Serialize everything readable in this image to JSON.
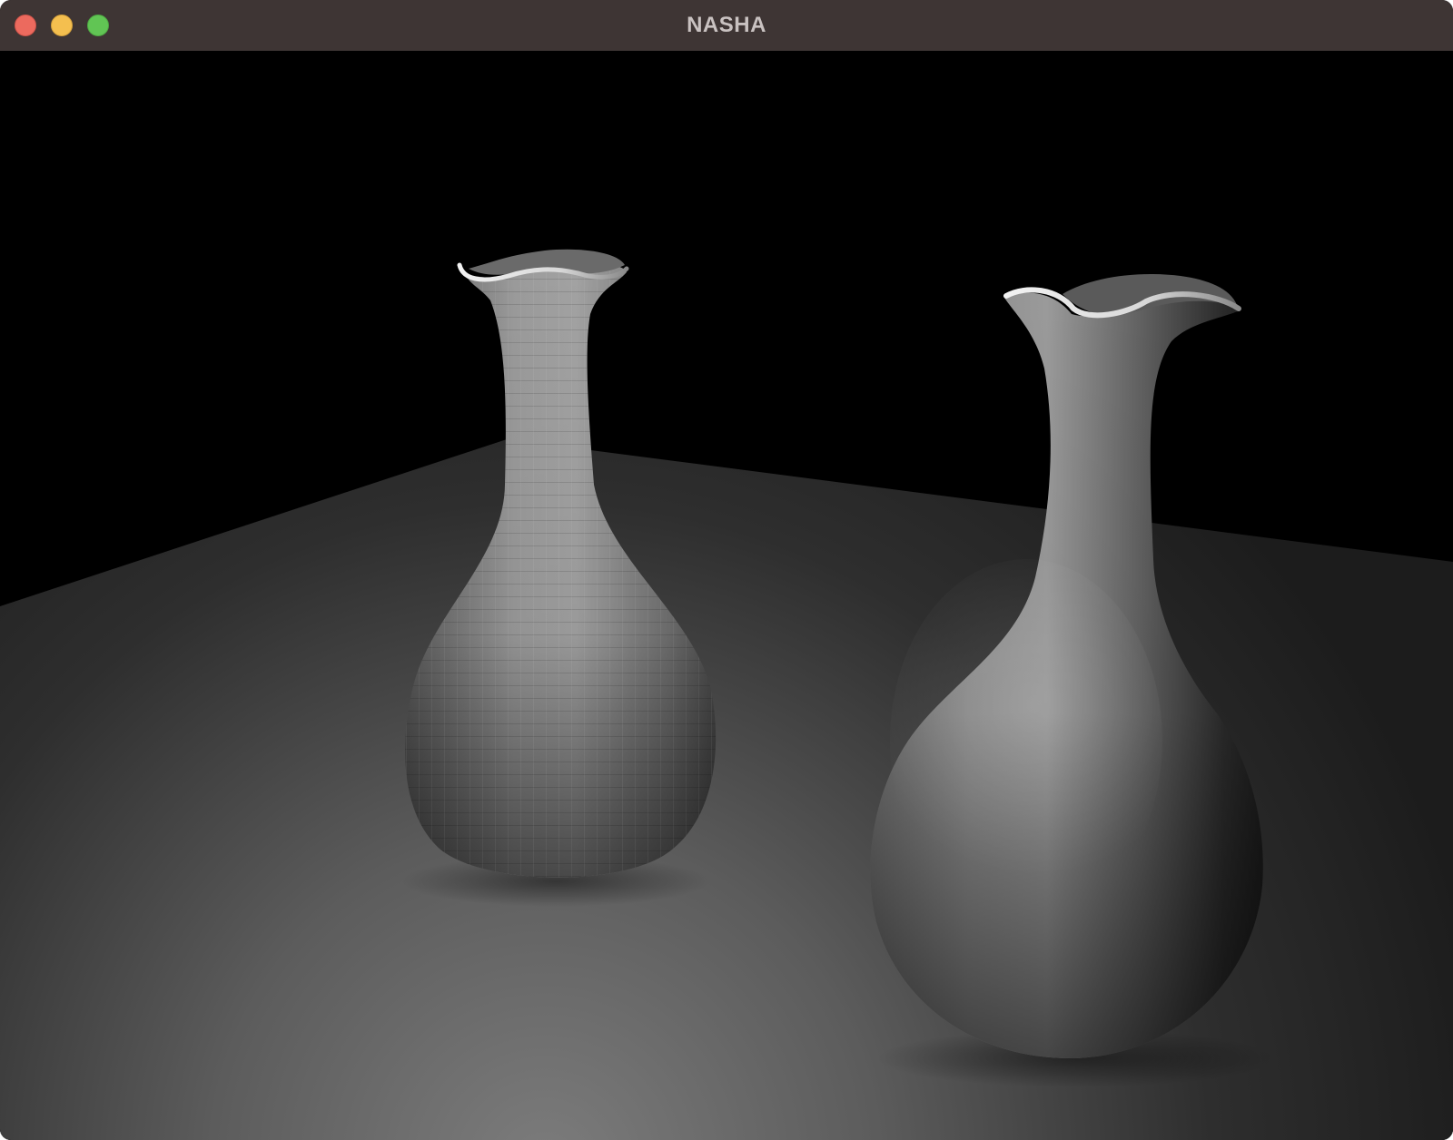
{
  "window": {
    "title": "NASHA",
    "controls": {
      "close_color": "#ec6a5e",
      "minimize_color": "#f4bf4f",
      "zoom_color": "#61c554"
    }
  },
  "scene": {
    "background_color": "#000000",
    "floor_color": "#7a7a7a",
    "objects": [
      {
        "name": "faceted-vase",
        "shading": "flat"
      },
      {
        "name": "smooth-vase",
        "shading": "smooth"
      }
    ]
  }
}
